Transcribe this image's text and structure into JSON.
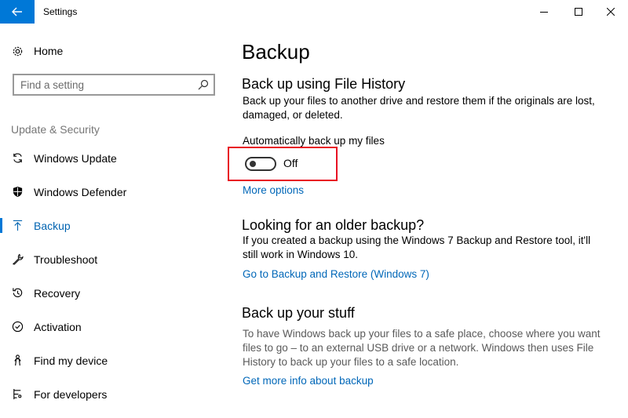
{
  "window": {
    "title": "Settings",
    "controls": [
      "minimize-icon",
      "maximize-icon",
      "close-icon"
    ]
  },
  "sidebar": {
    "home_label": "Home",
    "search": {
      "placeholder": "Find a setting",
      "value": ""
    },
    "section_label": "Update & Security",
    "items": [
      {
        "label": "Windows Update",
        "icon": "sync-icon",
        "active": false
      },
      {
        "label": "Windows Defender",
        "icon": "shield-icon",
        "active": false
      },
      {
        "label": "Backup",
        "icon": "backup-arrow-icon",
        "active": true
      },
      {
        "label": "Troubleshoot",
        "icon": "wrench-icon",
        "active": false
      },
      {
        "label": "Recovery",
        "icon": "history-icon",
        "active": false
      },
      {
        "label": "Activation",
        "icon": "check-circle-icon",
        "active": false
      },
      {
        "label": "Find my device",
        "icon": "person-icon",
        "active": false
      },
      {
        "label": "For developers",
        "icon": "developer-icon",
        "active": false
      }
    ]
  },
  "main": {
    "title": "Backup",
    "file_history": {
      "heading": "Back up using File History",
      "description": "Back up your files to another drive and restore them if the originals are lost, damaged, or deleted.",
      "toggle_label": "Automatically back up my files",
      "toggle_state": "Off",
      "toggle_on": false,
      "more_options": "More options"
    },
    "older_backup": {
      "heading": "Looking for an older backup?",
      "description": "If you created a backup using the Windows 7 Backup and Restore tool, it'll still work in Windows 10.",
      "link": "Go to Backup and Restore (Windows 7)"
    },
    "back_up_stuff": {
      "heading": "Back up your stuff",
      "description": "To have Windows back up your files to a safe place, choose where you want files to go – to an external USB drive or a network. Windows then uses File History to back up your files to a safe location.",
      "link": "Get more info about backup"
    }
  },
  "colors": {
    "accent": "#0078d7",
    "link": "#0067b8",
    "highlight": "#e81123"
  }
}
